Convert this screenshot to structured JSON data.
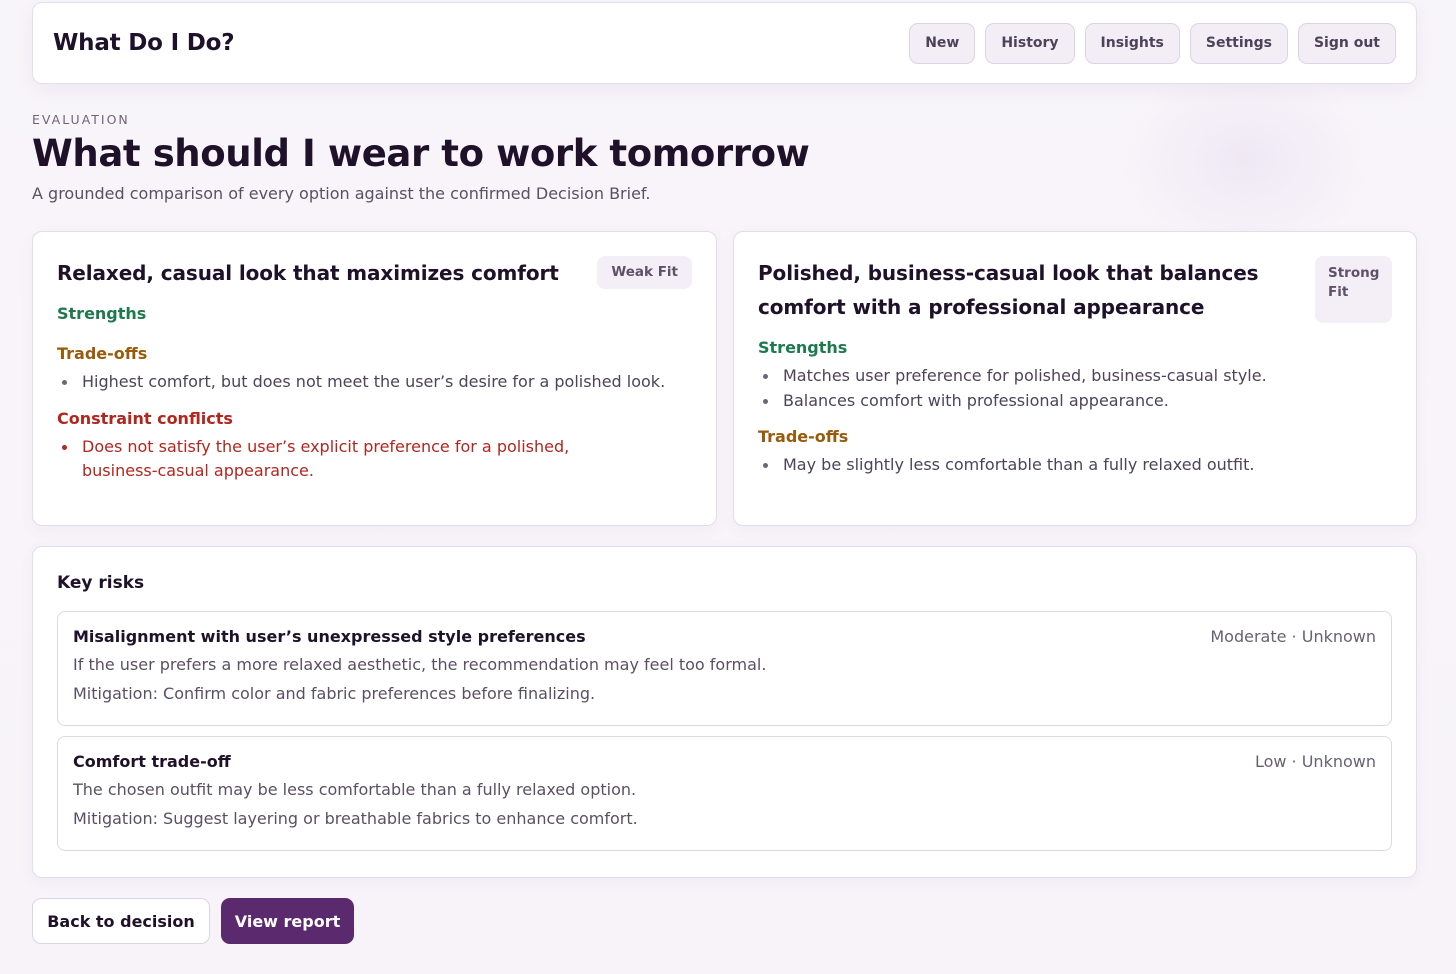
{
  "app": {
    "title": "What Do I Do?",
    "nav": [
      "New",
      "History",
      "Insights",
      "Settings",
      "Sign out"
    ]
  },
  "page": {
    "eyebrow": "EVALUATION",
    "title": "What should I wear to work tomorrow",
    "subtitle": "A grounded comparison of every option against the confirmed Decision Brief."
  },
  "options": [
    {
      "title": "Relaxed, casual look that maximizes comfort",
      "fit": "Weak Fit",
      "strengths_label": "Strengths",
      "strengths": [],
      "tradeoffs_label": "Trade-offs",
      "tradeoffs": [
        "Highest comfort, but does not meet the user’s desire for a polished look."
      ],
      "conflicts_label": "Constraint conflicts",
      "conflicts": [
        "Does not satisfy the user’s explicit preference for a polished, business-casual appearance."
      ]
    },
    {
      "title": "Polished, business-casual look that balances comfort with a professional appearance",
      "fit": "Strong Fit",
      "strengths_label": "Strengths",
      "strengths": [
        "Matches user preference for polished, business-casual style.",
        "Balances comfort with professional appearance."
      ],
      "tradeoffs_label": "Trade-offs",
      "tradeoffs": [
        "May be slightly less comfortable than a fully relaxed outfit."
      ]
    }
  ],
  "risks": {
    "title": "Key risks",
    "items": [
      {
        "name": "Misalignment with user’s unexpressed style preferences",
        "meta": "Moderate · Unknown",
        "description": "If the user prefers a more relaxed aesthetic, the recommendation may feel too formal.",
        "mitigation": "Mitigation: Confirm color and fabric preferences before finalizing."
      },
      {
        "name": "Comfort trade-off",
        "meta": "Low · Unknown",
        "description": "The chosen outfit may be less comfortable than a fully relaxed option.",
        "mitigation": "Mitigation: Suggest layering or breathable fabrics to enhance comfort."
      }
    ]
  },
  "actions": {
    "back": "Back to decision",
    "report": "View report"
  },
  "colors": {
    "accent": "#5b2a6e",
    "strength": "#1e7a4e",
    "tradeoff": "#9a5a0a",
    "conflict": "#b3261e"
  }
}
